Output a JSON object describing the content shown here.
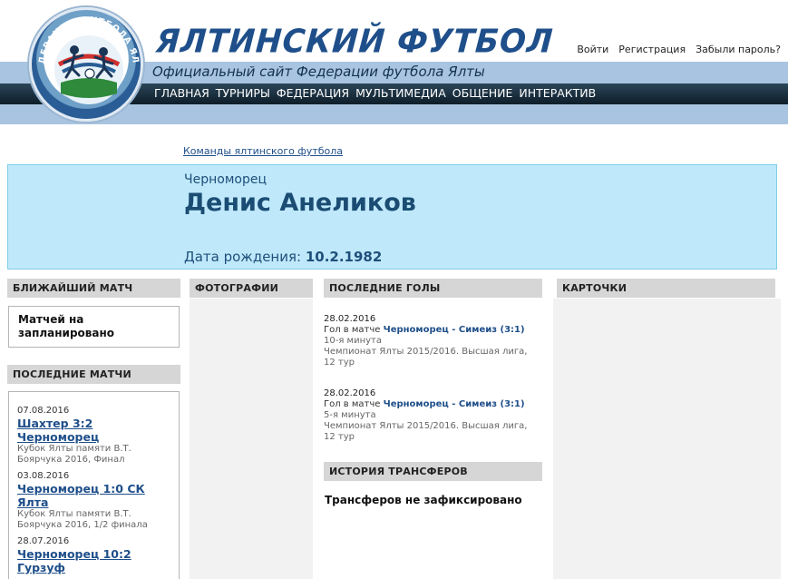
{
  "header": {
    "title": "ЯЛТИНСКИЙ ФУТБОЛ",
    "subtitle": "Официальный сайт Федерации футбола Ялты",
    "logo_text": "ФЕДЕРАЦИЯ ФУТБОЛА ЯЛТЫ",
    "nav": [
      "ГЛАВНАЯ",
      "ТУРНИРЫ",
      "ФЕДЕРАЦИЯ",
      "МУЛЬТИМЕДИА",
      "ОБЩЕНИЕ",
      "ИНТЕРАКТИВ"
    ],
    "auth": [
      "Войти",
      "Регистрация",
      "Забыли пароль?"
    ]
  },
  "breadcrumb": "Команды ялтинского футбола",
  "player": {
    "team": "Черноморец",
    "name": "Денис Анеликов",
    "dob_label": "Дата рождения:",
    "dob_value": "10.2.1982"
  },
  "sections": {
    "next_match": "БЛИЖАЙШИЙ МАТЧ",
    "photos": "ФОТОГРАФИИ",
    "last_goals": "ПОСЛЕДНИЕ ГОЛЫ",
    "cards": "КАРТОЧКИ",
    "last_matches": "ПОСЛЕДНИЕ МАТЧИ",
    "transfers": "ИСТОРИЯ ТРАНСФЕРОВ"
  },
  "next_match_text": "Матчей на запланировано",
  "last_matches": [
    {
      "date": "07.08.2016",
      "match": "Шахтер 3:2 Черноморец",
      "tournament": "Кубок Ялты памяти В.Т. Боярчука 2016, Финал"
    },
    {
      "date": "03.08.2016",
      "match": "Черноморец 1:0 СК Ялта",
      "tournament": "Кубок Ялты памяти В.Т. Боярчука 2016, 1/2 финала"
    },
    {
      "date": "28.07.2016",
      "match": "Черноморец 10:2 Гурзуф",
      "tournament": ""
    }
  ],
  "goals": [
    {
      "date": "28.02.2016",
      "prefix": "Гол в матче",
      "match": "Черноморец - Симеиз (3:1)",
      "minute": "10-я минута",
      "tournament": "Чемпионат Ялты 2015/2016. Высшая лига, 12 тур"
    },
    {
      "date": "28.02.2016",
      "prefix": "Гол в матче",
      "match": "Черноморец - Симеиз (3:1)",
      "minute": "5-я минута",
      "tournament": "Чемпионат Ялты 2015/2016. Высшая лига, 12 тур"
    }
  ],
  "transfers_text": "Трансферов не зафиксировано"
}
